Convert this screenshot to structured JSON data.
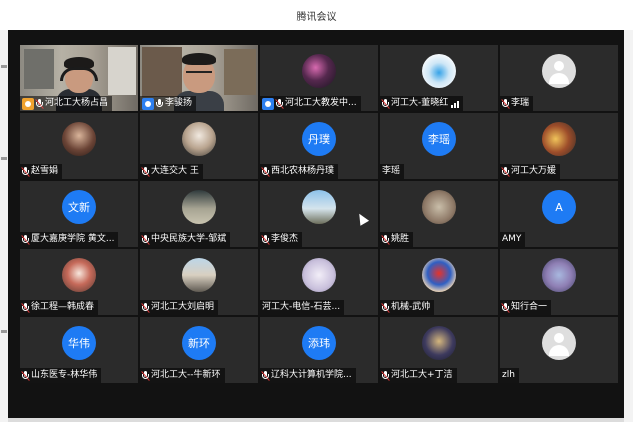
{
  "window": {
    "title": "腾讯会议"
  },
  "participants": [
    {
      "name": "河北工大杨占昌",
      "kind": "video",
      "host": true,
      "mic": "muted"
    },
    {
      "name": "李骏扬",
      "kind": "video",
      "host": true,
      "mic": "on"
    },
    {
      "name": "河北工大教发中...",
      "kind": "photo",
      "photo": "photo1",
      "host": true,
      "mic": "muted"
    },
    {
      "name": "河工大-董晓红",
      "kind": "photo",
      "photo": "photo2",
      "host": false,
      "mic": "muted",
      "signal": true
    },
    {
      "name": "李瑞",
      "kind": "default",
      "host": false,
      "mic": "muted"
    },
    {
      "name": "赵雪娟",
      "kind": "photo",
      "photo": "photo3",
      "host": false,
      "mic": "muted"
    },
    {
      "name": "大连交大 王",
      "kind": "photo",
      "photo": "photo4",
      "host": false,
      "mic": "muted"
    },
    {
      "name": "西北农林杨丹璞",
      "kind": "text",
      "initials": "丹璞",
      "host": false,
      "mic": "muted"
    },
    {
      "name": "李瑶",
      "kind": "text",
      "initials": "李瑶",
      "host": false,
      "mic": "none"
    },
    {
      "name": "河工大万媛",
      "kind": "photo",
      "photo": "photo5",
      "host": false,
      "mic": "muted"
    },
    {
      "name": "厦大嘉庚学院 黄文...",
      "kind": "text",
      "initials": "文新",
      "host": false,
      "mic": "muted"
    },
    {
      "name": "中央民族大学-邹斌",
      "kind": "photo",
      "photo": "photo6",
      "host": false,
      "mic": "muted"
    },
    {
      "name": "李俊杰",
      "kind": "photo",
      "photo": "photo7",
      "host": false,
      "mic": "muted"
    },
    {
      "name": "姚胜",
      "kind": "photo",
      "photo": "photo8",
      "host": false,
      "mic": "muted"
    },
    {
      "name": "AMY",
      "kind": "text",
      "initials": "A",
      "host": false,
      "mic": "none"
    },
    {
      "name": "徐工程—韩成春",
      "kind": "photo",
      "photo": "photo9",
      "host": false,
      "mic": "muted"
    },
    {
      "name": "河北工大刘启明",
      "kind": "photo",
      "photo": "photo10",
      "host": false,
      "mic": "muted"
    },
    {
      "name": "河工大-电信-石芸...",
      "kind": "photo",
      "photo": "photo11",
      "host": false,
      "mic": "none"
    },
    {
      "name": "机械-武帅",
      "kind": "photo",
      "photo": "photo12",
      "host": false,
      "mic": "muted"
    },
    {
      "name": "知行合一",
      "kind": "photo",
      "photo": "photo13",
      "host": false,
      "mic": "muted"
    },
    {
      "name": "山东医专-林华伟",
      "kind": "text",
      "initials": "华伟",
      "host": false,
      "mic": "muted"
    },
    {
      "name": "河北工大--牛新环",
      "kind": "text",
      "initials": "新环",
      "host": false,
      "mic": "muted"
    },
    {
      "name": "辽科大计算机学院...",
      "kind": "text",
      "initials": "添玮",
      "host": false,
      "mic": "muted"
    },
    {
      "name": "河北工大+丁洁",
      "kind": "photo",
      "photo": "photo14",
      "host": false,
      "mic": "muted"
    },
    {
      "name": "zlh",
      "kind": "default",
      "host": false,
      "mic": "none"
    }
  ],
  "colors": {
    "accent": "#1e7bf4",
    "host_badge": "#f0a22e",
    "host_badge_alt": "#2d7ff0",
    "muted_slash": "#e03a3a"
  }
}
